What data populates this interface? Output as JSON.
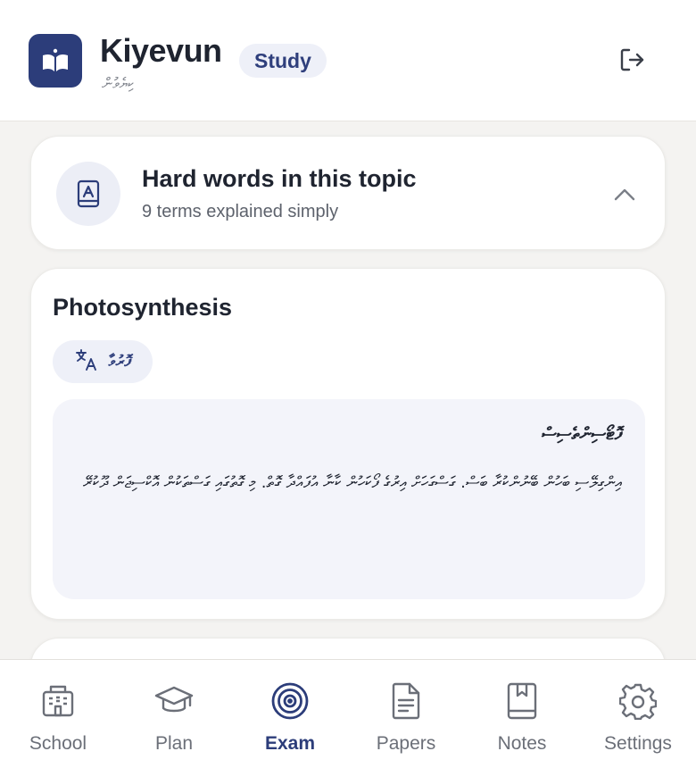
{
  "header": {
    "app_name": "Kiyevun",
    "app_subtitle": "ކިޔެވުން",
    "mode_badge": "Study",
    "logo_icon": "open-book-icon",
    "logout_icon": "logout-icon"
  },
  "hard_words": {
    "title": "Hard words in this topic",
    "subtitle": "9 terms explained simply",
    "icon": "dictionary-icon",
    "toggle_icon": "chevron-up-icon"
  },
  "term": {
    "title": "Photosynthesis",
    "translate_label": "ފޮރުވާ",
    "translate_icon": "translate-icon",
    "explanation_heading": "ފޮޓޯސިންތެސިސް",
    "explanation_body": "އިންގިލޭސި ބަހުން ބޭނުންކުރާ ބަސް. ގަސްގަހަށް އިރުގެ ފޯކަހުން ކާނާ އުފައްދާ ގޮތް. މި ގޮތުގައި ގަސްތަކުން އޮކްސިޖަން ދޫކުރޭ"
  },
  "nav": {
    "items": [
      {
        "label": "School",
        "icon": "school-building-icon"
      },
      {
        "label": "Plan",
        "icon": "graduation-cap-icon"
      },
      {
        "label": "Exam",
        "icon": "target-icon"
      },
      {
        "label": "Papers",
        "icon": "document-icon"
      },
      {
        "label": "Notes",
        "icon": "notebook-icon"
      },
      {
        "label": "Settings",
        "icon": "gear-icon"
      }
    ],
    "active_index": 2
  },
  "colors": {
    "accent": "#2c3d7a",
    "inactive": "#6b6f78"
  }
}
